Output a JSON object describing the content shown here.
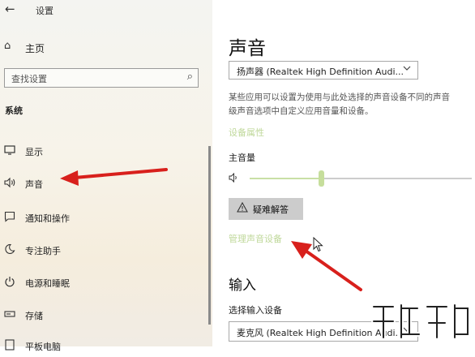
{
  "window": {
    "title": "设置"
  },
  "sidebar": {
    "home_label": "主页",
    "search_placeholder": "查找设置",
    "section_label": "系统",
    "items": [
      {
        "label": "显示",
        "icon": "monitor-icon"
      },
      {
        "label": "声音",
        "icon": "speaker-icon"
      },
      {
        "label": "通知和操作",
        "icon": "notification-icon"
      },
      {
        "label": "专注助手",
        "icon": "moon-icon"
      },
      {
        "label": "电源和睡眠",
        "icon": "power-icon"
      },
      {
        "label": "存储",
        "icon": "storage-icon"
      },
      {
        "label": "平板电脑",
        "icon": "tablet-icon"
      }
    ]
  },
  "main": {
    "title": "声音",
    "output_device": "扬声器 (Realtek High Definition Audi...",
    "description_line1": "某些应用可以设置为使用与此处选择的声音设备不同的声音",
    "description_line2": "级声音选项中自定义应用音量和设备。",
    "device_properties_link": "设备属性",
    "master_volume_label": "主音量",
    "volume_fraction": 0.32,
    "troubleshoot_label": "疑难解答",
    "manage_devices_link": "管理声音设备",
    "input_header": "输入",
    "input_label": "选择输入设备",
    "input_device": "麦克风 (Realtek High Definition Audi..."
  },
  "colors": {
    "accent_link": "#bfd89a",
    "annotation_arrow": "#d8201c"
  }
}
